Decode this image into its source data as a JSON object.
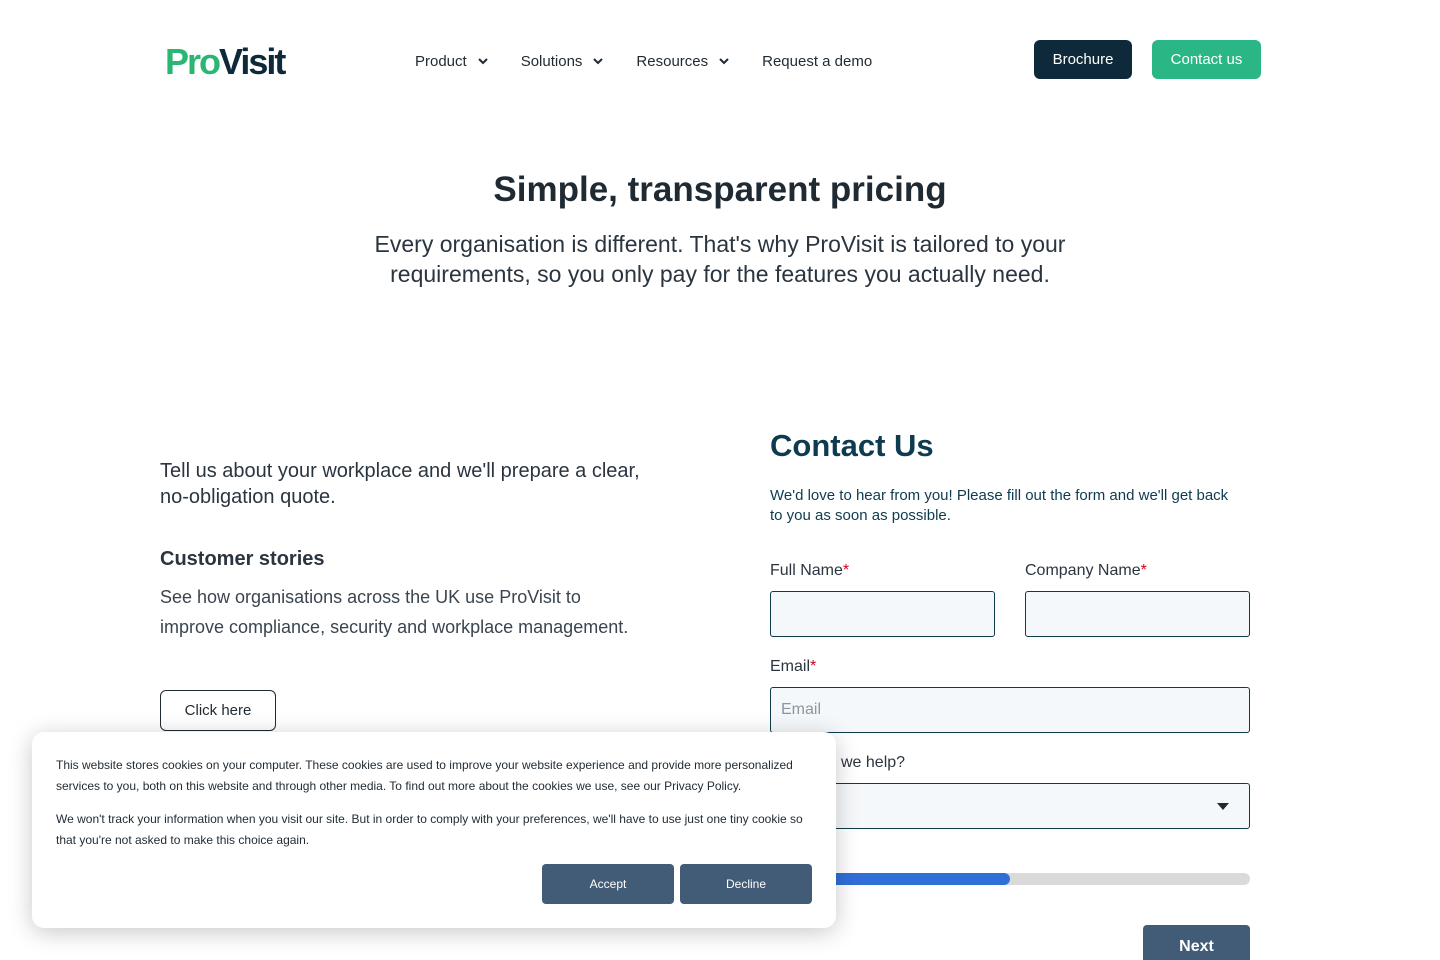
{
  "brand": {
    "logo_pro": "Pro",
    "logo_visit": "Visit"
  },
  "nav": {
    "items": [
      {
        "label": "Product",
        "has_dropdown": true
      },
      {
        "label": "Solutions",
        "has_dropdown": true
      },
      {
        "label": "Resources",
        "has_dropdown": true
      },
      {
        "label": "Request a demo",
        "has_dropdown": false
      }
    ],
    "brochure_label": "Brochure",
    "contact_label": "Contact us"
  },
  "hero": {
    "title": "Simple, transparent pricing",
    "subtitle": "Every organisation is different. That's why ProVisit is tailored to your requirements, so you only pay for the features you actually need."
  },
  "left": {
    "intro": "Tell us about your workplace and we'll prepare a clear, no-obligation quote.",
    "stories_title": "Customer stories",
    "stories_text": "See how organisations across the UK use ProVisit to improve compliance, security and workplace management.",
    "click_label": "Click here"
  },
  "form": {
    "title": "Contact Us",
    "description": "We'd love to hear from you! Please fill out the form and we'll get back to you as soon as possible.",
    "full_name_label": "Full Name",
    "company_name_label": "Company Name",
    "email_label": "Email",
    "email_placeholder": "Email",
    "help_label_visible": "we help?",
    "required_mark": "*",
    "progress_fraction": 0.5,
    "next_label": "Next"
  },
  "cookie": {
    "text1": "This website stores cookies on your computer. These cookies are used to improve your website experience and provide more personalized services to you, both on this website and through other media. To find out more about the cookies we use, see our Privacy Policy.",
    "text2": "We won't track your information when you visit our site. But in order to comply with your preferences, we'll have to use just one tiny cookie so that you're not asked to make this choice again.",
    "accept_label": "Accept",
    "decline_label": "Decline"
  },
  "colors": {
    "brand_green": "#2bb686",
    "navy": "#0e2a3a",
    "progress_blue": "#2f6fd8",
    "button_slate": "#425b76"
  }
}
